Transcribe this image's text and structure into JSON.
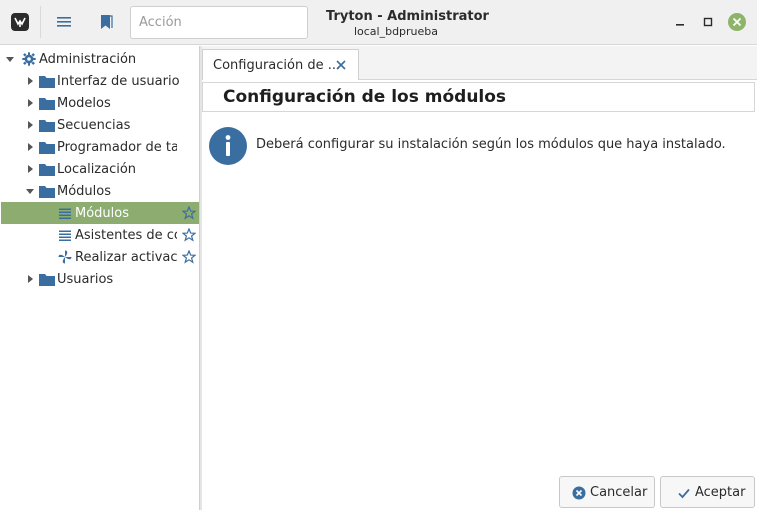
{
  "header": {
    "title": "Tryton - Administrator",
    "subtitle": "local_bdprueba",
    "search_placeholder": "Acción",
    "icons": [
      "tryton-logo-icon",
      "menu-icon",
      "bookmark-icon",
      "minimize-icon",
      "maximize-icon",
      "close-icon"
    ]
  },
  "sidebar": {
    "items": [
      {
        "label": "Administración",
        "icon": "gear-icon",
        "expanded": true
      },
      {
        "label": "Interfaz de usuario",
        "icon": "folder-icon"
      },
      {
        "label": "Modelos",
        "icon": "folder-icon"
      },
      {
        "label": "Secuencias",
        "icon": "folder-icon"
      },
      {
        "label": "Programador de tare",
        "icon": "folder-icon"
      },
      {
        "label": "Localización",
        "icon": "folder-icon"
      },
      {
        "label": "Módulos",
        "icon": "folder-icon",
        "expanded": true
      },
      {
        "label": "Módulos",
        "icon": "list-icon",
        "selected": true
      },
      {
        "label": "Asistentes de con",
        "icon": "list-icon"
      },
      {
        "label": "Realizar activacio",
        "icon": "wizard-icon"
      },
      {
        "label": "Usuarios",
        "icon": "folder-icon"
      }
    ]
  },
  "tab": {
    "label": "Configuración de ..."
  },
  "page": {
    "title": "Configuración de los módulos",
    "message": "Deberá configurar su instalación según los módulos que haya instalado."
  },
  "buttons": {
    "cancel": "Cancelar",
    "ok": "Aceptar"
  },
  "colors": {
    "selection": "#8cad6f",
    "info": "#3b6ea0",
    "close": "#8cb56a",
    "star": "#3b6ea0"
  }
}
